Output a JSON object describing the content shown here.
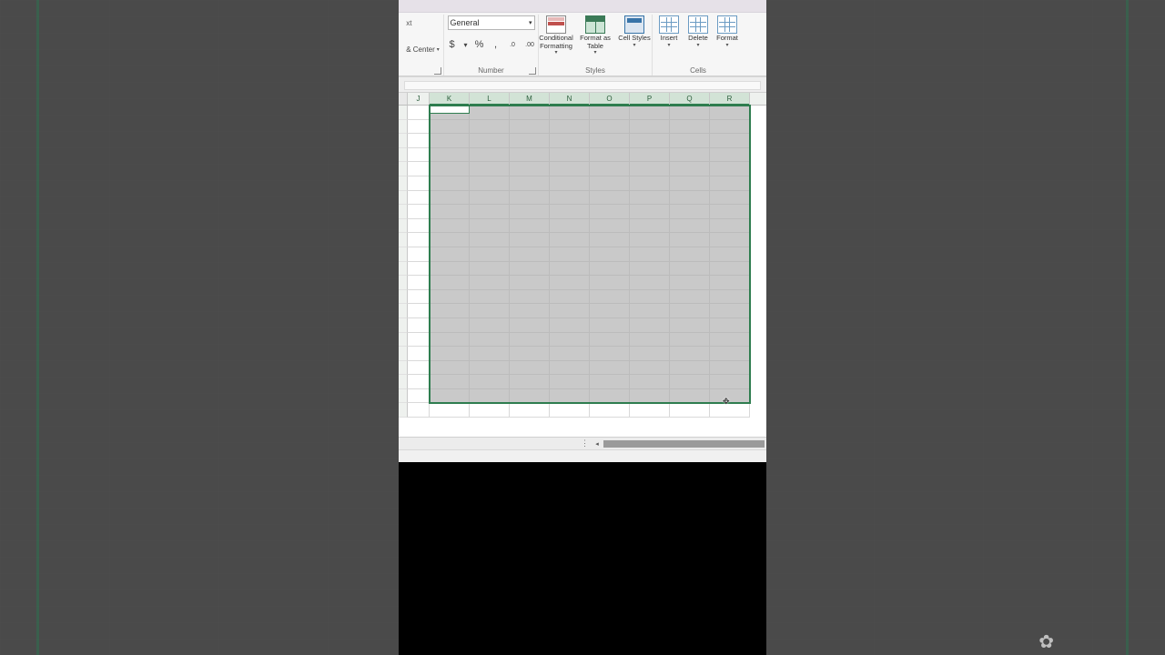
{
  "ribbon": {
    "alignment": {
      "wrap_fragment": "xt",
      "merge_center_fragment": "& Center"
    },
    "number": {
      "format": "General",
      "currency": "$",
      "percent": "%",
      "comma": ",",
      "inc_decimal": ".0→",
      "dec_decimal": "←.0",
      "group_label": "Number"
    },
    "styles": {
      "conditional": "Conditional Formatting",
      "format_table": "Format as Table",
      "cell_styles": "Cell Styles",
      "group_label": "Styles"
    },
    "cells": {
      "insert": "Insert",
      "delete": "Delete",
      "format": "Format",
      "group_label": "Cells"
    }
  },
  "columns": [
    "J",
    "K",
    "L",
    "M",
    "N",
    "O",
    "P",
    "Q",
    "R"
  ],
  "selection": {
    "start_col": "K",
    "end_col": "R",
    "row_count": 21,
    "active_cell": "K1"
  },
  "cursor_glyph": "✥",
  "watermark_glyph": "✿"
}
